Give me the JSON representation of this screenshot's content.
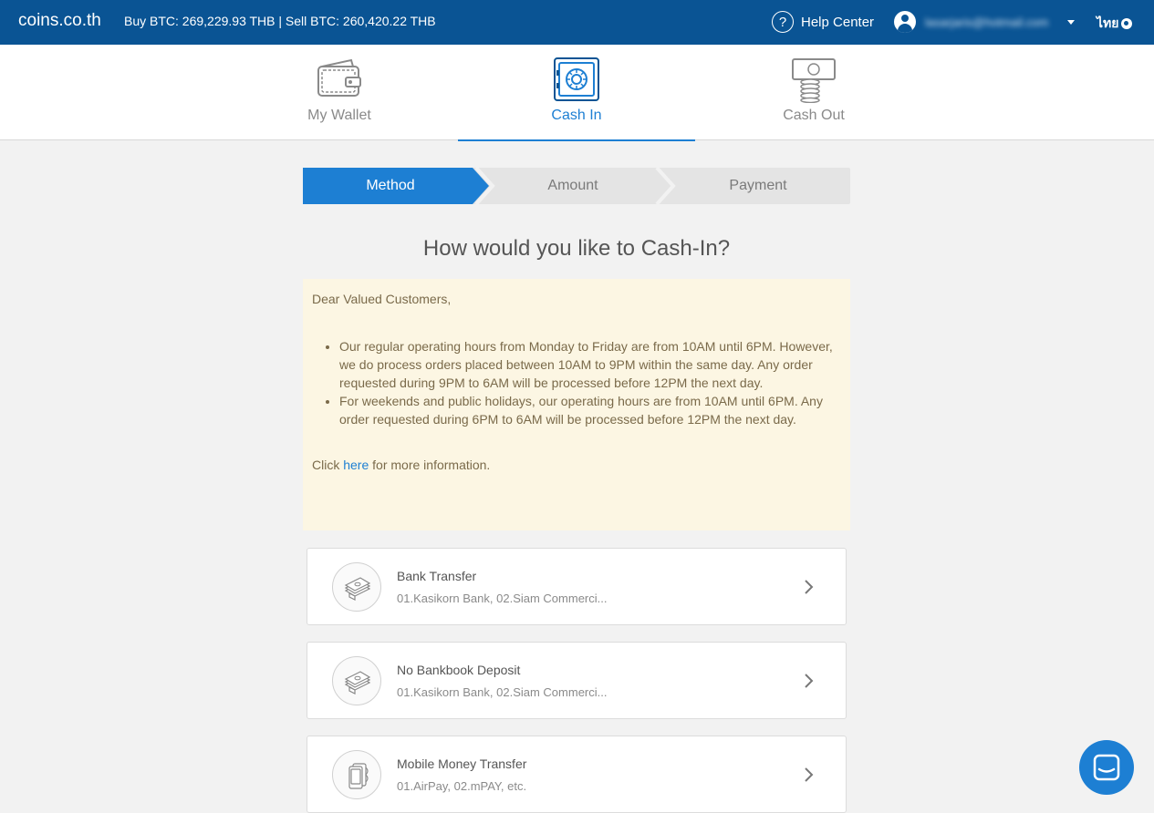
{
  "header": {
    "brand": "coins.co.th",
    "prices": "Buy BTC: 269,229.93 THB | Sell BTC: 260,420.22 THB",
    "help_icon": "?",
    "help_label": "Help Center",
    "user_email": "lasarjaris@hotmail.com",
    "language": "ไทย"
  },
  "nav": {
    "tabs": [
      {
        "label": "My Wallet",
        "icon": "wallet-icon"
      },
      {
        "label": "Cash In",
        "icon": "safe-icon",
        "active": true
      },
      {
        "label": "Cash Out",
        "icon": "cash-out-icon"
      }
    ]
  },
  "stepper": {
    "steps": [
      "Method",
      "Amount",
      "Payment"
    ],
    "active_index": 0
  },
  "heading": "How would you like to Cash-In?",
  "notice": {
    "greeting": "Dear Valued Customers,",
    "bullets": [
      "Our regular operating hours from Monday to Friday are from 10AM until 6PM. However, we do process orders placed between 10AM to 9PM within the same day. Any order requested during 9PM to 6AM will be processed before 12PM the next day.",
      "For weekends and public holidays, our operating hours are from 10AM until 6PM. Any order requested during 6PM to 6AM will be processed before 12PM the next day."
    ],
    "click_prefix": "Click ",
    "click_link": "here",
    "click_suffix": " for more information."
  },
  "methods": [
    {
      "title": "Bank Transfer",
      "subtitle": "01.Kasikorn Bank, 02.Siam Commerci...",
      "icon": "cash-stack-icon"
    },
    {
      "title": "No Bankbook Deposit",
      "subtitle": "01.Kasikorn Bank, 02.Siam Commerci...",
      "icon": "cash-stack-icon"
    },
    {
      "title": "Mobile Money Transfer",
      "subtitle": "01.AirPay, 02.mPAY, etc.",
      "icon": "mobile-money-icon"
    }
  ],
  "colors": {
    "topbar": "#0a5494",
    "accent": "#1d7fd3",
    "notice_bg": "#fcf6e3"
  }
}
